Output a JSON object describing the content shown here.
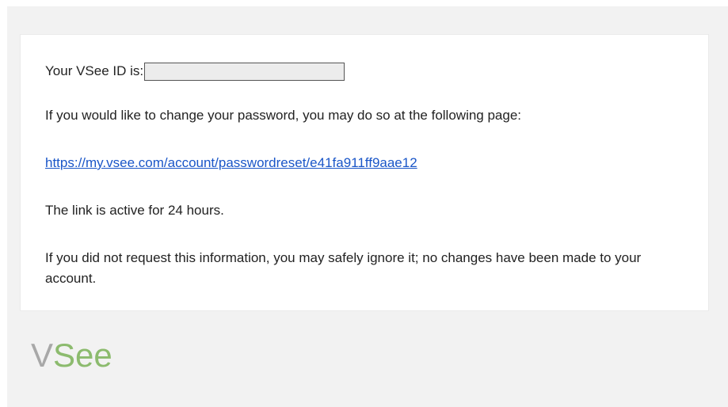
{
  "email": {
    "vsee_id_label": "Your VSee ID is:",
    "vsee_id_value": "",
    "change_password_text": "If you would like to change your password, you may do so at the following page:",
    "reset_link": "https://my.vsee.com/account/passwordreset/e41fa911ff9aae12",
    "link_active_text": "The link is active for 24 hours.",
    "ignore_text": "If you did not request this information, you may safely ignore it; no changes have been made to your account."
  },
  "footer": {
    "logo_v": "V",
    "logo_see": "See"
  },
  "colors": {
    "background": "#f2f2f2",
    "card": "#ffffff",
    "link": "#1a56c8",
    "logo_gray": "#a8a8a8",
    "logo_green": "#8cbb6e"
  }
}
